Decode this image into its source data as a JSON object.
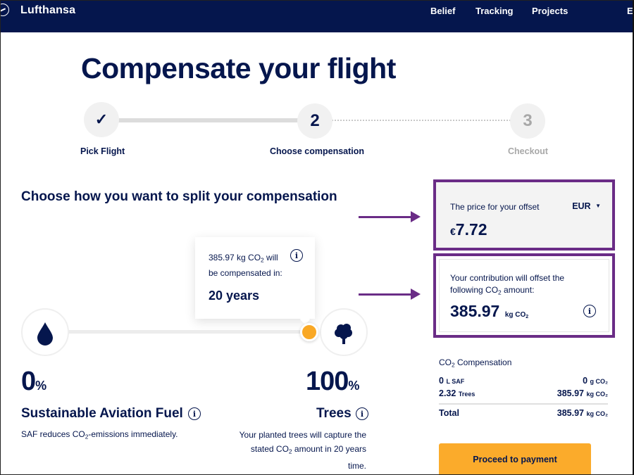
{
  "header": {
    "brand": "Lufthansa",
    "nav": [
      "Belief",
      "Tracking",
      "Projects",
      "E"
    ]
  },
  "page_title": "Compensate your flight",
  "stepper": {
    "steps": [
      {
        "number": "✓",
        "label": "Pick Flight",
        "state": "done"
      },
      {
        "number": "2",
        "label": "Choose compensation",
        "state": "active"
      },
      {
        "number": "3",
        "label": "Checkout",
        "state": "inactive"
      }
    ]
  },
  "split": {
    "title": "Choose how you want to split your compensation",
    "tooltip": {
      "text_line1_pre": "385.97 kg CO",
      "text_line1_sub": "2",
      "text_line1_post": " will",
      "text_line2": "be compensated in:",
      "value": "20 years"
    },
    "slider_value_percent_trees": 100,
    "saf": {
      "percent": "0",
      "percent_sign": "%",
      "title": "Sustainable Aviation Fuel",
      "desc_pre": "SAF reduces CO",
      "desc_sub": "2",
      "desc_post": "-emissions immediately."
    },
    "trees": {
      "percent": "100",
      "percent_sign": "%",
      "title": "Trees",
      "desc_line1": "Your planted trees will capture the",
      "desc_line2_pre": "stated CO",
      "desc_line2_sub": "2",
      "desc_line2_post": " amount in 20 years",
      "desc_line3": "time."
    }
  },
  "price_box": {
    "label": "The price for your offset",
    "currency": "EUR",
    "currency_symbol": "€",
    "amount": "7.72"
  },
  "co2_box": {
    "label_line1": "Your contribution will offset the",
    "label_line2_pre": "following CO",
    "label_line2_sub": "2",
    "label_line2_post": " amount:",
    "amount": "385.97",
    "unit_pre": "kg CO",
    "unit_sub": "2"
  },
  "compensation": {
    "heading_pre": "CO",
    "heading_sub": "2",
    "heading_post": " Compensation",
    "rows": [
      {
        "left_value": "0",
        "left_unit": "L SAF",
        "right_value": "0",
        "right_unit": "g CO₂"
      },
      {
        "left_value": "2.32",
        "left_unit": "Trees",
        "right_value": "385.97",
        "right_unit": "kg CO₂"
      }
    ],
    "total": {
      "label": "Total",
      "value": "385.97",
      "unit": "kg CO₂"
    }
  },
  "proceed_button": "Proceed to payment",
  "annotation_color": "#6a2c86",
  "accent_color": "#fbab2b",
  "brand_color": "#05164d"
}
